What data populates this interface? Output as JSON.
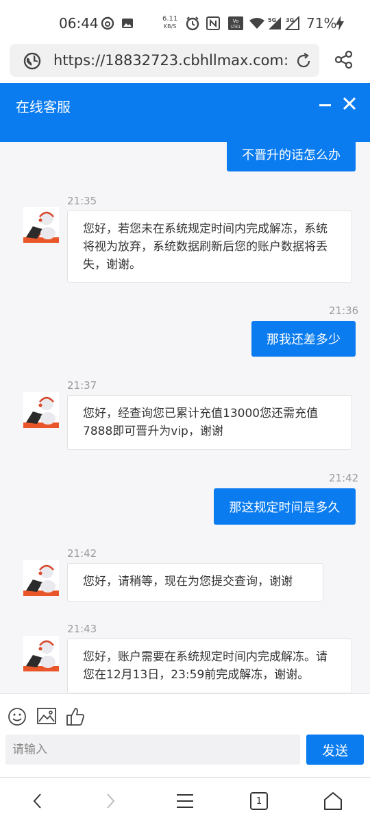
{
  "status_bar": {
    "time": "06:44",
    "net_speed_value": "6.11",
    "net_speed_unit": "KB/S",
    "battery": "71%",
    "signal_5g": "5G",
    "signal_3g": "3G",
    "volte": "VoLTE1"
  },
  "browser": {
    "url": "https://18832723.cbhllmax.com:"
  },
  "chat": {
    "title": "在线客服",
    "messages": [
      {
        "side": "right",
        "text": "不晋升的话怎么办"
      },
      {
        "side": "left",
        "time": "21:35",
        "text": "您好，若您未在系统规定时间内完成解冻，系统将视为放弃，系统数据刷新后您的账户数据将丢失，谢谢。"
      },
      {
        "side": "right",
        "time": "21:36",
        "text": "那我还差多少"
      },
      {
        "side": "left",
        "time": "21:37",
        "text": "您好，经查询您已累计充值13000您还需充值7888即可晋升为vip，谢谢"
      },
      {
        "side": "right",
        "time": "21:42",
        "text": "那这规定时间是多久"
      },
      {
        "side": "left",
        "time": "21:42",
        "text": "您好，请稍等，现在为您提交查询，谢谢"
      },
      {
        "side": "left",
        "time": "21:43",
        "text": "您好，账户需要在系统规定时间内完成解冻。请您在12月13日，23:59前完成解冻，谢谢。"
      }
    ]
  },
  "composer": {
    "placeholder": "请输入",
    "send_label": "发送"
  },
  "nav": {
    "tab_count": "1"
  },
  "colors": {
    "accent": "#0a7cf0",
    "chat_bg": "#f6f6f8"
  }
}
